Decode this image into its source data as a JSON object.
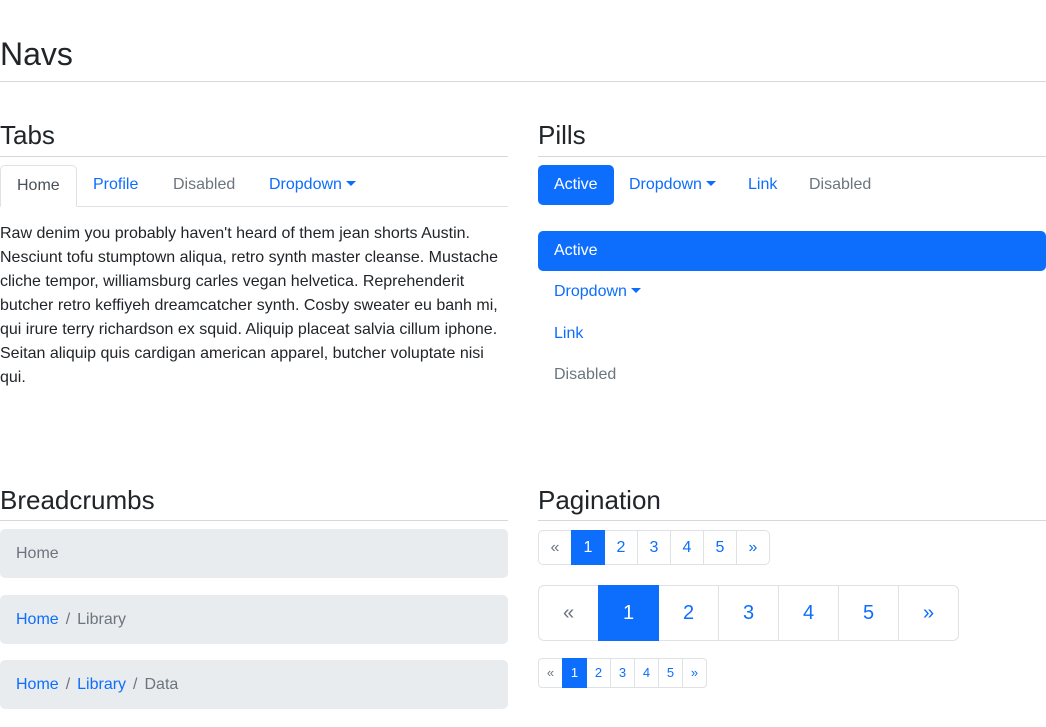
{
  "page": {
    "title": "Navs"
  },
  "tabs_section": {
    "title": "Tabs",
    "tabs": [
      {
        "label": "Home",
        "state": "active"
      },
      {
        "label": "Profile",
        "state": "normal"
      },
      {
        "label": "Disabled",
        "state": "disabled"
      },
      {
        "label": "Dropdown",
        "state": "dropdown"
      }
    ],
    "content": "Raw denim you probably haven't heard of them jean shorts Austin. Nesciunt tofu stumptown aliqua, retro synth master cleanse. Mustache cliche tempor, williamsburg carles vegan helvetica. Reprehenderit butcher retro keffiyeh dreamcatcher synth. Cosby sweater eu banh mi, qui irure terry richardson ex squid. Aliquip placeat salvia cillum iphone. Seitan aliquip quis cardigan american apparel, butcher voluptate nisi qui."
  },
  "pills_section": {
    "title": "Pills",
    "horizontal": [
      {
        "label": "Active",
        "state": "active"
      },
      {
        "label": "Dropdown",
        "state": "dropdown"
      },
      {
        "label": "Link",
        "state": "normal"
      },
      {
        "label": "Disabled",
        "state": "disabled"
      }
    ],
    "vertical": [
      {
        "label": "Active",
        "state": "active"
      },
      {
        "label": "Dropdown",
        "state": "dropdown"
      },
      {
        "label": "Link",
        "state": "normal"
      },
      {
        "label": "Disabled",
        "state": "disabled"
      }
    ]
  },
  "breadcrumbs_section": {
    "title": "Breadcrumbs",
    "separator": "/",
    "trails": [
      {
        "items": [
          "Home"
        ]
      },
      {
        "items": [
          "Home",
          "Library"
        ]
      },
      {
        "items": [
          "Home",
          "Library",
          "Data"
        ]
      }
    ]
  },
  "pagination_section": {
    "title": "Pagination",
    "prev": "«",
    "next": "»",
    "pages": [
      "1",
      "2",
      "3",
      "4",
      "5"
    ],
    "active_page": "1"
  },
  "colors": {
    "primary": "#0d6efd",
    "muted": "#6c757d",
    "breadcrumb_bg": "#e9ecef",
    "border": "#dee2e6"
  }
}
